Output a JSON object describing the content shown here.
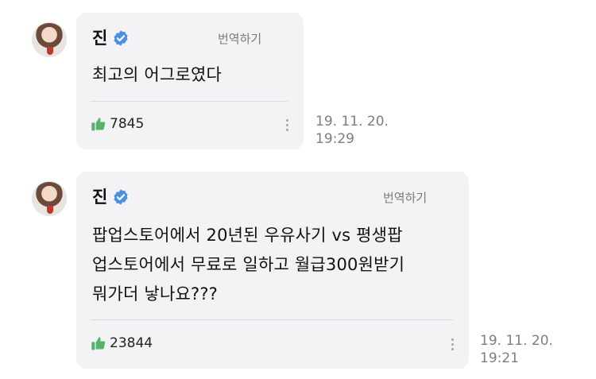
{
  "comments": [
    {
      "author": "진",
      "translate_label": "번역하기",
      "text_lines": [
        "최고의 어그로였다"
      ],
      "likes": "7845",
      "date": "19. 11. 20.",
      "time": "19:29"
    },
    {
      "author": "진",
      "translate_label": "번역하기",
      "text_lines": [
        "팝업스토어에서 20년된 우유사기 vs 평생팝",
        "업스토어에서 무료로 일하고 월급300원받기",
        "뭐가더 낳나요???"
      ],
      "likes": "23844",
      "date": "19. 11. 20.",
      "time": "19:21"
    }
  ],
  "colors": {
    "bubble": "#f3f3f6",
    "verified": "#4a90e2",
    "like": "#55b46a"
  },
  "icons": {
    "verified": "verified-badge-icon",
    "like": "thumbs-up-icon",
    "more": "more-vertical-icon"
  }
}
